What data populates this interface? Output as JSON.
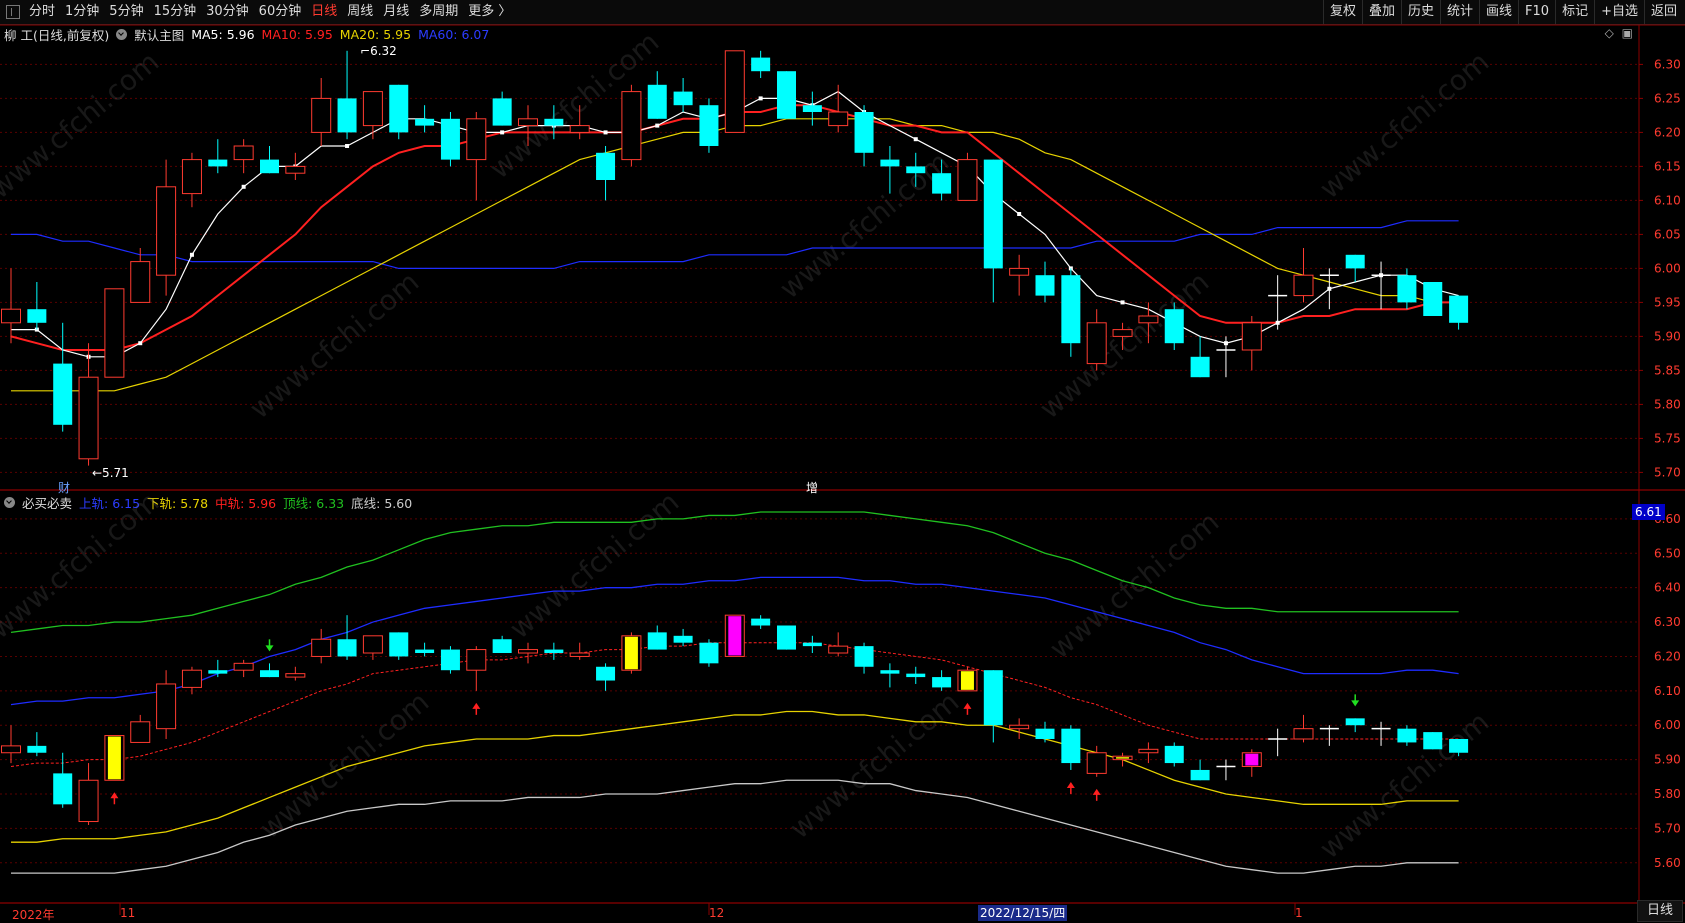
{
  "toolbar": {
    "tabs": [
      "分时",
      "1分钟",
      "5分钟",
      "15分钟",
      "30分钟",
      "60分钟",
      "日线",
      "周线",
      "月线",
      "多周期",
      "更多 〉"
    ],
    "active_tab": "日线",
    "right": [
      "复权",
      "叠加",
      "历史",
      "统计",
      "画线",
      "F10",
      "标记",
      "+自选",
      "返回"
    ]
  },
  "main_legend": {
    "stock": "柳 工(日线,前复权)",
    "template": "默认主图",
    "ma5": "MA5: 5.96",
    "ma10": "MA10: 5.95",
    "ma20": "MA20: 5.95",
    "ma60": "MA60: 6.07"
  },
  "sub_legend": {
    "name": "必买必卖",
    "upper": "上轨: 6.15",
    "lower": "下轨: 5.78",
    "mid": "中轨: 5.96",
    "top": "顶线: 6.33",
    "bottom": "底线: 5.60"
  },
  "annotations": {
    "high": "6.32",
    "low": "←5.71",
    "cai": "财",
    "zeng": "增"
  },
  "price_axis_main": [
    "6.30",
    "6.25",
    "6.20",
    "6.15",
    "6.10",
    "6.05",
    "6.00",
    "5.95",
    "5.90",
    "5.85",
    "5.80",
    "5.75",
    "5.70"
  ],
  "price_axis_sub": [
    "6.60",
    "6.50",
    "6.40",
    "6.30",
    "6.20",
    "6.10",
    "6.00",
    "5.90",
    "5.80",
    "5.70",
    "5.60"
  ],
  "sub_axis_tag": "6.61",
  "date_axis": {
    "year": "2022年",
    "m11": "11",
    "m12": "12",
    "cursor_date": "2022/12/15/四",
    "m1": "1"
  },
  "period_button": "日线",
  "watermark": "www.cfchi.com",
  "colors": {
    "up": "#ff3b30",
    "down": "#00ffff",
    "ma5": "#ffffff",
    "ma10": "#ff2020",
    "ma20": "#e6d200",
    "ma60": "#1e2cff",
    "top_line": "#20c020",
    "bottom_line": "#c8c8c8"
  },
  "chart_data": {
    "type": "candlestick",
    "ylim_main": [
      5.68,
      6.33
    ],
    "ylim_sub": [
      5.55,
      6.62
    ],
    "candles": [
      {
        "o": 5.92,
        "h": 6.0,
        "l": 5.89,
        "c": 5.94
      },
      {
        "o": 5.94,
        "h": 5.98,
        "l": 5.91,
        "c": 5.92
      },
      {
        "o": 5.86,
        "h": 5.92,
        "l": 5.76,
        "c": 5.77
      },
      {
        "o": 5.72,
        "h": 5.89,
        "l": 5.71,
        "c": 5.84
      },
      {
        "o": 5.84,
        "h": 5.97,
        "l": 5.84,
        "c": 5.97
      },
      {
        "o": 5.95,
        "h": 6.03,
        "l": 5.95,
        "c": 6.01
      },
      {
        "o": 5.99,
        "h": 6.16,
        "l": 5.96,
        "c": 6.12
      },
      {
        "o": 6.11,
        "h": 6.17,
        "l": 6.09,
        "c": 6.16
      },
      {
        "o": 6.16,
        "h": 6.19,
        "l": 6.14,
        "c": 6.15
      },
      {
        "o": 6.16,
        "h": 6.19,
        "l": 6.14,
        "c": 6.18
      },
      {
        "o": 6.16,
        "h": 6.18,
        "l": 6.14,
        "c": 6.14
      },
      {
        "o": 6.14,
        "h": 6.17,
        "l": 6.13,
        "c": 6.15
      },
      {
        "o": 6.2,
        "h": 6.28,
        "l": 6.18,
        "c": 6.25
      },
      {
        "o": 6.25,
        "h": 6.32,
        "l": 6.19,
        "c": 6.2
      },
      {
        "o": 6.21,
        "h": 6.26,
        "l": 6.19,
        "c": 6.26
      },
      {
        "o": 6.27,
        "h": 6.27,
        "l": 6.19,
        "c": 6.2
      },
      {
        "o": 6.22,
        "h": 6.24,
        "l": 6.2,
        "c": 6.21
      },
      {
        "o": 6.22,
        "h": 6.23,
        "l": 6.15,
        "c": 6.16
      },
      {
        "o": 6.16,
        "h": 6.23,
        "l": 6.1,
        "c": 6.22
      },
      {
        "o": 6.25,
        "h": 6.26,
        "l": 6.21,
        "c": 6.21
      },
      {
        "o": 6.21,
        "h": 6.24,
        "l": 6.18,
        "c": 6.22
      },
      {
        "o": 6.22,
        "h": 6.24,
        "l": 6.19,
        "c": 6.21
      },
      {
        "o": 6.2,
        "h": 6.24,
        "l": 6.19,
        "c": 6.21
      },
      {
        "o": 6.17,
        "h": 6.18,
        "l": 6.1,
        "c": 6.13
      },
      {
        "o": 6.16,
        "h": 6.27,
        "l": 6.15,
        "c": 6.26
      },
      {
        "o": 6.27,
        "h": 6.29,
        "l": 6.22,
        "c": 6.22
      },
      {
        "o": 6.26,
        "h": 6.28,
        "l": 6.23,
        "c": 6.24
      },
      {
        "o": 6.24,
        "h": 6.25,
        "l": 6.17,
        "c": 6.18
      },
      {
        "o": 6.2,
        "h": 6.32,
        "l": 6.2,
        "c": 6.32
      },
      {
        "o": 6.31,
        "h": 6.32,
        "l": 6.28,
        "c": 6.29
      },
      {
        "o": 6.29,
        "h": 6.29,
        "l": 6.22,
        "c": 6.22
      },
      {
        "o": 6.24,
        "h": 6.26,
        "l": 6.21,
        "c": 6.23
      },
      {
        "o": 6.21,
        "h": 6.27,
        "l": 6.2,
        "c": 6.23
      },
      {
        "o": 6.23,
        "h": 6.24,
        "l": 6.15,
        "c": 6.17
      },
      {
        "o": 6.16,
        "h": 6.18,
        "l": 6.11,
        "c": 6.15
      },
      {
        "o": 6.15,
        "h": 6.17,
        "l": 6.12,
        "c": 6.14
      },
      {
        "o": 6.14,
        "h": 6.16,
        "l": 6.1,
        "c": 6.11
      },
      {
        "o": 6.1,
        "h": 6.17,
        "l": 6.1,
        "c": 6.16
      },
      {
        "o": 6.16,
        "h": 6.16,
        "l": 5.95,
        "c": 6.0
      },
      {
        "o": 5.99,
        "h": 6.02,
        "l": 5.96,
        "c": 6.0
      },
      {
        "o": 5.99,
        "h": 6.01,
        "l": 5.95,
        "c": 5.96
      },
      {
        "o": 5.99,
        "h": 6.0,
        "l": 5.87,
        "c": 5.89
      },
      {
        "o": 5.86,
        "h": 5.94,
        "l": 5.85,
        "c": 5.92
      },
      {
        "o": 5.9,
        "h": 5.92,
        "l": 5.88,
        "c": 5.91
      },
      {
        "o": 5.92,
        "h": 5.95,
        "l": 5.89,
        "c": 5.93
      },
      {
        "o": 5.94,
        "h": 5.95,
        "l": 5.88,
        "c": 5.89
      },
      {
        "o": 5.87,
        "h": 5.9,
        "l": 5.84,
        "c": 5.84
      },
      {
        "o": 5.88,
        "h": 5.9,
        "l": 5.84,
        "c": 5.88
      },
      {
        "o": 5.88,
        "h": 5.93,
        "l": 5.85,
        "c": 5.92
      },
      {
        "o": 5.96,
        "h": 5.99,
        "l": 5.91,
        "c": 5.96
      },
      {
        "o": 5.96,
        "h": 6.03,
        "l": 5.95,
        "c": 5.99
      },
      {
        "o": 5.99,
        "h": 6.0,
        "l": 5.94,
        "c": 5.99
      },
      {
        "o": 6.02,
        "h": 6.02,
        "l": 5.98,
        "c": 6.0
      },
      {
        "o": 5.99,
        "h": 6.01,
        "l": 5.94,
        "c": 5.99
      },
      {
        "o": 5.99,
        "h": 6.0,
        "l": 5.94,
        "c": 5.95
      },
      {
        "o": 5.98,
        "h": 5.98,
        "l": 5.93,
        "c": 5.93
      },
      {
        "o": 5.96,
        "h": 5.96,
        "l": 5.91,
        "c": 5.92
      }
    ],
    "ma5": [
      5.91,
      5.91,
      5.88,
      5.87,
      5.87,
      5.89,
      5.94,
      6.02,
      6.08,
      6.12,
      6.15,
      6.15,
      6.18,
      6.18,
      6.2,
      6.22,
      6.22,
      6.21,
      6.2,
      6.2,
      6.21,
      6.21,
      6.21,
      6.2,
      6.2,
      6.21,
      6.23,
      6.22,
      6.23,
      6.25,
      6.25,
      6.24,
      6.26,
      6.23,
      6.21,
      6.19,
      6.17,
      6.15,
      6.11,
      6.08,
      6.05,
      6.0,
      5.96,
      5.95,
      5.94,
      5.92,
      5.9,
      5.89,
      5.9,
      5.92,
      5.94,
      5.97,
      5.98,
      5.99,
      5.99,
      5.97,
      5.96
    ],
    "ma10": [
      5.9,
      5.89,
      5.88,
      5.88,
      5.88,
      5.89,
      5.91,
      5.93,
      5.96,
      5.99,
      6.02,
      6.05,
      6.09,
      6.12,
      6.15,
      6.17,
      6.18,
      6.18,
      6.19,
      6.2,
      6.2,
      6.2,
      6.2,
      6.2,
      6.2,
      6.21,
      6.22,
      6.22,
      6.23,
      6.23,
      6.24,
      6.24,
      6.23,
      6.22,
      6.21,
      6.21,
      6.2,
      6.2,
      6.17,
      6.14,
      6.11,
      6.08,
      6.05,
      6.02,
      5.99,
      5.96,
      5.93,
      5.92,
      5.92,
      5.92,
      5.93,
      5.93,
      5.94,
      5.94,
      5.94,
      5.95,
      5.95
    ],
    "ma20": [
      5.82,
      5.82,
      5.82,
      5.82,
      5.82,
      5.83,
      5.84,
      5.86,
      5.88,
      5.9,
      5.92,
      5.94,
      5.96,
      5.98,
      6.0,
      6.02,
      6.04,
      6.06,
      6.08,
      6.1,
      6.12,
      6.14,
      6.16,
      6.17,
      6.18,
      6.19,
      6.2,
      6.2,
      6.21,
      6.21,
      6.22,
      6.22,
      6.22,
      6.22,
      6.22,
      6.21,
      6.21,
      6.2,
      6.2,
      6.19,
      6.17,
      6.16,
      6.14,
      6.12,
      6.1,
      6.08,
      6.06,
      6.04,
      6.02,
      6.0,
      5.99,
      5.98,
      5.97,
      5.96,
      5.96,
      5.95,
      5.95
    ],
    "ma60": [
      6.05,
      6.05,
      6.04,
      6.04,
      6.03,
      6.02,
      6.02,
      6.01,
      6.01,
      6.01,
      6.01,
      6.01,
      6.01,
      6.01,
      6.01,
      6.0,
      6.0,
      6.0,
      6.0,
      6.0,
      6.0,
      6.0,
      6.01,
      6.01,
      6.01,
      6.01,
      6.01,
      6.02,
      6.02,
      6.02,
      6.02,
      6.03,
      6.03,
      6.03,
      6.03,
      6.03,
      6.03,
      6.03,
      6.03,
      6.03,
      6.03,
      6.03,
      6.04,
      6.04,
      6.04,
      6.04,
      6.05,
      6.05,
      6.05,
      6.06,
      6.06,
      6.06,
      6.06,
      6.06,
      6.07,
      6.07,
      6.07
    ],
    "sub_top": [
      6.27,
      6.28,
      6.29,
      6.29,
      6.3,
      6.3,
      6.31,
      6.32,
      6.34,
      6.36,
      6.38,
      6.41,
      6.43,
      6.46,
      6.48,
      6.51,
      6.54,
      6.56,
      6.57,
      6.58,
      6.58,
      6.59,
      6.59,
      6.59,
      6.59,
      6.6,
      6.6,
      6.61,
      6.61,
      6.62,
      6.62,
      6.62,
      6.62,
      6.62,
      6.61,
      6.6,
      6.59,
      6.58,
      6.56,
      6.53,
      6.5,
      6.48,
      6.45,
      6.42,
      6.4,
      6.37,
      6.35,
      6.34,
      6.34,
      6.33,
      6.33,
      6.33,
      6.33,
      6.33,
      6.33,
      6.33,
      6.33
    ],
    "sub_upper": [
      6.06,
      6.07,
      6.07,
      6.08,
      6.08,
      6.09,
      6.1,
      6.12,
      6.15,
      6.17,
      6.2,
      6.22,
      6.25,
      6.27,
      6.3,
      6.32,
      6.34,
      6.35,
      6.36,
      6.37,
      6.38,
      6.39,
      6.39,
      6.4,
      6.4,
      6.41,
      6.41,
      6.42,
      6.42,
      6.43,
      6.43,
      6.43,
      6.43,
      6.42,
      6.42,
      6.41,
      6.41,
      6.4,
      6.39,
      6.38,
      6.37,
      6.35,
      6.33,
      6.31,
      6.29,
      6.27,
      6.24,
      6.22,
      6.19,
      6.17,
      6.15,
      6.15,
      6.15,
      6.15,
      6.16,
      6.16,
      6.15
    ],
    "sub_mid": [
      5.88,
      5.89,
      5.89,
      5.9,
      5.9,
      5.91,
      5.93,
      5.95,
      5.98,
      6.01,
      6.04,
      6.07,
      6.1,
      6.12,
      6.15,
      6.16,
      6.17,
      6.18,
      6.19,
      6.19,
      6.2,
      6.21,
      6.21,
      6.22,
      6.22,
      6.23,
      6.23,
      6.24,
      6.24,
      6.24,
      6.24,
      6.24,
      6.23,
      6.22,
      6.21,
      6.2,
      6.19,
      6.17,
      6.15,
      6.13,
      6.11,
      6.08,
      6.06,
      6.03,
      6.0,
      5.98,
      5.96,
      5.96,
      5.96,
      5.96,
      5.96,
      5.96,
      5.96,
      5.96,
      5.96,
      5.96,
      5.96
    ],
    "sub_lower": [
      5.66,
      5.66,
      5.67,
      5.67,
      5.67,
      5.68,
      5.69,
      5.71,
      5.73,
      5.76,
      5.79,
      5.82,
      5.85,
      5.88,
      5.9,
      5.92,
      5.94,
      5.95,
      5.96,
      5.96,
      5.96,
      5.97,
      5.97,
      5.98,
      5.99,
      6.0,
      6.01,
      6.02,
      6.03,
      6.03,
      6.04,
      6.04,
      6.03,
      6.03,
      6.02,
      6.01,
      6.01,
      6.0,
      6.0,
      5.98,
      5.96,
      5.94,
      5.92,
      5.9,
      5.87,
      5.84,
      5.82,
      5.8,
      5.79,
      5.78,
      5.77,
      5.77,
      5.77,
      5.77,
      5.78,
      5.78,
      5.78
    ],
    "sub_bottom": [
      5.57,
      5.57,
      5.57,
      5.57,
      5.57,
      5.58,
      5.59,
      5.61,
      5.63,
      5.66,
      5.68,
      5.71,
      5.73,
      5.75,
      5.76,
      5.77,
      5.77,
      5.78,
      5.78,
      5.78,
      5.79,
      5.79,
      5.79,
      5.8,
      5.8,
      5.8,
      5.81,
      5.82,
      5.83,
      5.83,
      5.84,
      5.84,
      5.84,
      5.83,
      5.83,
      5.81,
      5.8,
      5.79,
      5.77,
      5.75,
      5.73,
      5.71,
      5.69,
      5.67,
      5.65,
      5.63,
      5.61,
      5.59,
      5.58,
      5.57,
      5.57,
      5.58,
      5.59,
      5.59,
      5.6,
      5.6,
      5.6
    ],
    "sub_up_arrows": [
      4,
      18,
      37,
      41,
      42
    ],
    "sub_down_arrows": [
      10,
      52
    ],
    "sub_yellow_bars": [
      4,
      24,
      37,
      43
    ],
    "sub_magenta_bars": [
      28,
      48
    ]
  }
}
